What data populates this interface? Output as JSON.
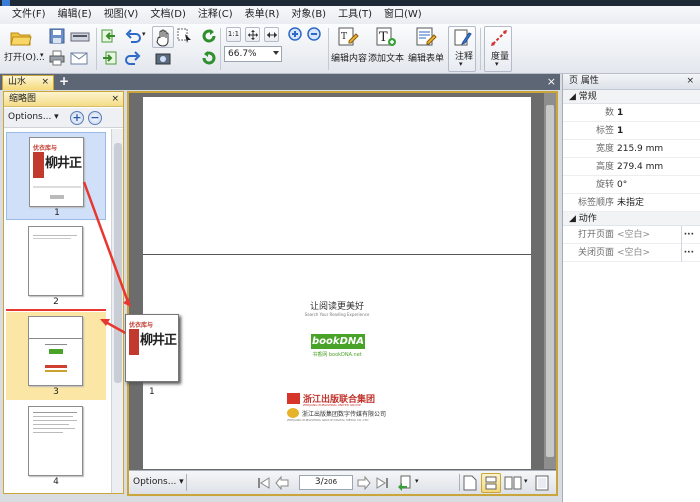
{
  "menu": [
    "文件(F)",
    "编辑(E)",
    "视图(V)",
    "文档(D)",
    "注释(C)",
    "表单(R)",
    "对象(B)",
    "工具(T)",
    "窗口(W)"
  ],
  "toolbar": {
    "open_label": "打开(O)...",
    "zoom_value": "66.7%",
    "edit_content_label": "编辑内容",
    "add_text_label": "添加文本",
    "edit_form_label": "编辑表单",
    "annotate_label": "注释",
    "measure_label": "度量",
    "actual_size_glyph": "1:1"
  },
  "tabs": {
    "document_tab_label": "山水",
    "close_glyph": "×",
    "add_glyph": "+"
  },
  "thumbnails": {
    "panel_title": "缩略图",
    "options_label": "Options...",
    "pages": [
      {
        "number": "1"
      },
      {
        "number": "2"
      },
      {
        "number": "3"
      },
      {
        "number": "4"
      }
    ],
    "cover_title_cn": "优衣库与",
    "cover_big_text": "柳井正"
  },
  "document": {
    "slogan": "让阅读更美好",
    "slogan_sub": "Search Your Reading Experience",
    "logo_text_book": "book",
    "logo_text_dna": "DNA",
    "logo_caption": "书香网 bookDNA.net",
    "publisher_group": "浙江出版联合集团",
    "publisher_group_en": "ZHEJIANG PUBLISHING UNITED GROUP",
    "publisher_digital": "浙江出版集团数字传媒有限公司",
    "publisher_digital_en": "ZHEJIANG PUBLISHING GROUP DIGITAL MEDIA CO.,LTD"
  },
  "drag_thumb": {
    "label": "1"
  },
  "nav": {
    "options_label": "Options...",
    "current_page": "3",
    "total_pages": "206"
  },
  "properties": {
    "panel_title": "页 属性",
    "section_general": "常规",
    "section_actions": "动作",
    "rows": [
      {
        "key": "数",
        "value": "1",
        "bold": true
      },
      {
        "key": "标签",
        "value": "1",
        "bold": true
      },
      {
        "key": "宽度",
        "value": "215.9 mm"
      },
      {
        "key": "高度",
        "value": "279.4 mm"
      },
      {
        "key": "旋转",
        "value": "0°"
      },
      {
        "key": "标签顺序",
        "value": "未指定"
      }
    ],
    "action_rows": [
      {
        "key": "打开页面",
        "value": "<空白>"
      },
      {
        "key": "关闭页面",
        "value": "<空白>"
      }
    ],
    "more_glyph": "···"
  },
  "colors": {
    "accent_arrow": "#e8372f",
    "tab_active": "#f5d978",
    "selection_blue": "#cfe0f8",
    "current_yellow": "#fbe6a6",
    "bookdna_green": "#4aa329"
  },
  "icons": [
    "folder-open-icon",
    "save-icon",
    "print-icon",
    "email-icon",
    "undo-icon",
    "redo-icon",
    "hand-icon",
    "select-icon",
    "rotate-icon",
    "camera-icon",
    "zoom-in-icon",
    "zoom-out-icon",
    "edit-content-icon",
    "add-text-icon",
    "edit-form-icon",
    "annotate-icon",
    "measure-icon"
  ]
}
